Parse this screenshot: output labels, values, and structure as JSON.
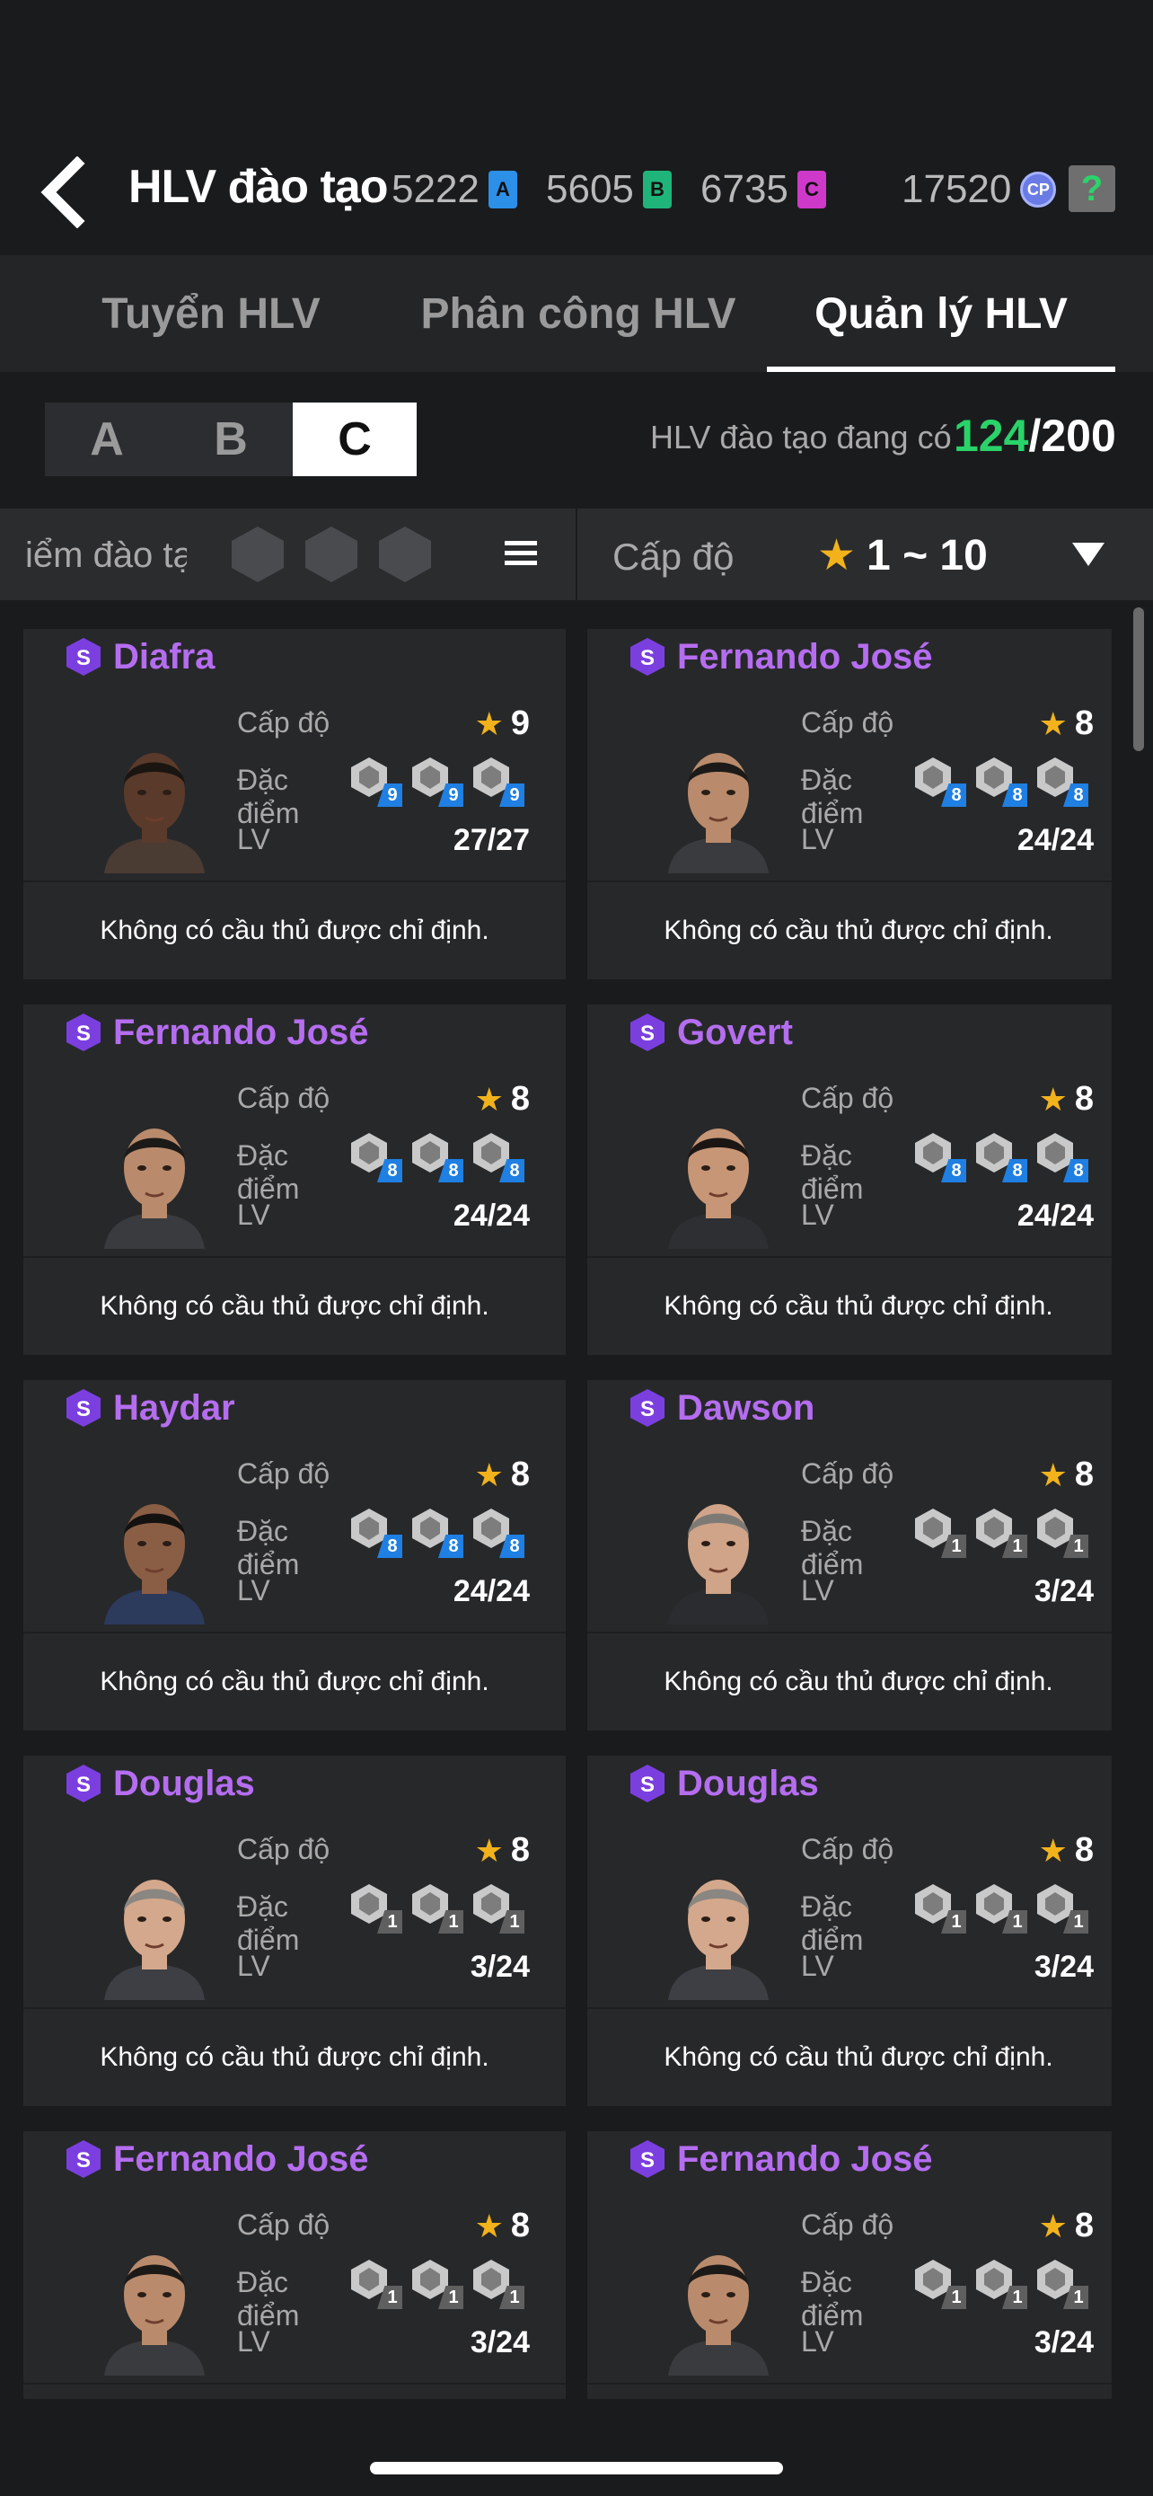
{
  "header": {
    "title": "HLV đào tạo",
    "currencies": [
      {
        "value": "5222",
        "ticket": "A"
      },
      {
        "value": "5605",
        "ticket": "B"
      },
      {
        "value": "6735",
        "ticket": "C"
      }
    ],
    "cp": {
      "value": "17520",
      "icon": "CP"
    },
    "help": "?"
  },
  "tabs": [
    "Tuyển HLV",
    "Phân công HLV",
    "Quản lý HLV"
  ],
  "groups": [
    "A",
    "B",
    "C"
  ],
  "count": {
    "label": "HLV đào tạo đang có",
    "current": "124",
    "total": "/200"
  },
  "filter": {
    "points_label": "iểm đào tạo",
    "level_label": "Cấp độ",
    "level_star": "★",
    "level_range": "1 ~ 10"
  },
  "labels": {
    "level": "Cấp độ",
    "trait": "Đặc điểm",
    "lv": "LV",
    "star": "★",
    "s": "S"
  },
  "cards": [
    {
      "name": "Diafra",
      "level": "9",
      "lv": "27/27",
      "traits": [
        "9",
        "9",
        "9"
      ],
      "trait_color": "blue",
      "footer": "Không có cầu thủ được chỉ định."
    },
    {
      "name": "Fernando José",
      "level": "8",
      "lv": "24/24",
      "traits": [
        "8",
        "8",
        "8"
      ],
      "trait_color": "blue",
      "footer": "Không có cầu thủ được chỉ định."
    },
    {
      "name": "Fernando José",
      "level": "8",
      "lv": "24/24",
      "traits": [
        "8",
        "8",
        "8"
      ],
      "trait_color": "blue",
      "footer": "Không có cầu thủ được chỉ định."
    },
    {
      "name": "Govert",
      "level": "8",
      "lv": "24/24",
      "traits": [
        "8",
        "8",
        "8"
      ],
      "trait_color": "blue",
      "footer": "Không có cầu thủ được chỉ định."
    },
    {
      "name": "Haydar",
      "level": "8",
      "lv": "24/24",
      "traits": [
        "8",
        "8",
        "8"
      ],
      "trait_color": "blue",
      "footer": "Không có cầu thủ được chỉ định."
    },
    {
      "name": "Dawson",
      "level": "8",
      "lv": "3/24",
      "traits": [
        "1",
        "1",
        "1"
      ],
      "trait_color": "gray",
      "footer": "Không có cầu thủ được chỉ định."
    },
    {
      "name": "Douglas",
      "level": "8",
      "lv": "3/24",
      "traits": [
        "1",
        "1",
        "1"
      ],
      "trait_color": "gray",
      "footer": "Không có cầu thủ được chỉ định."
    },
    {
      "name": "Douglas",
      "level": "8",
      "lv": "3/24",
      "traits": [
        "1",
        "1",
        "1"
      ],
      "trait_color": "gray",
      "footer": "Không có cầu thủ được chỉ định."
    },
    {
      "name": "Fernando José",
      "level": "8",
      "lv": "3/24",
      "traits": [
        "1",
        "1",
        "1"
      ],
      "trait_color": "gray",
      "footer": ""
    },
    {
      "name": "Fernando José",
      "level": "8",
      "lv": "3/24",
      "traits": [
        "1",
        "1",
        "1"
      ],
      "trait_color": "gray",
      "footer": ""
    }
  ],
  "colors": {
    "accent_green": "#2ad36a",
    "name_purple": "#b56df0",
    "star_gold": "#f2b21b",
    "trait_blue": "#1f7fe2"
  }
}
